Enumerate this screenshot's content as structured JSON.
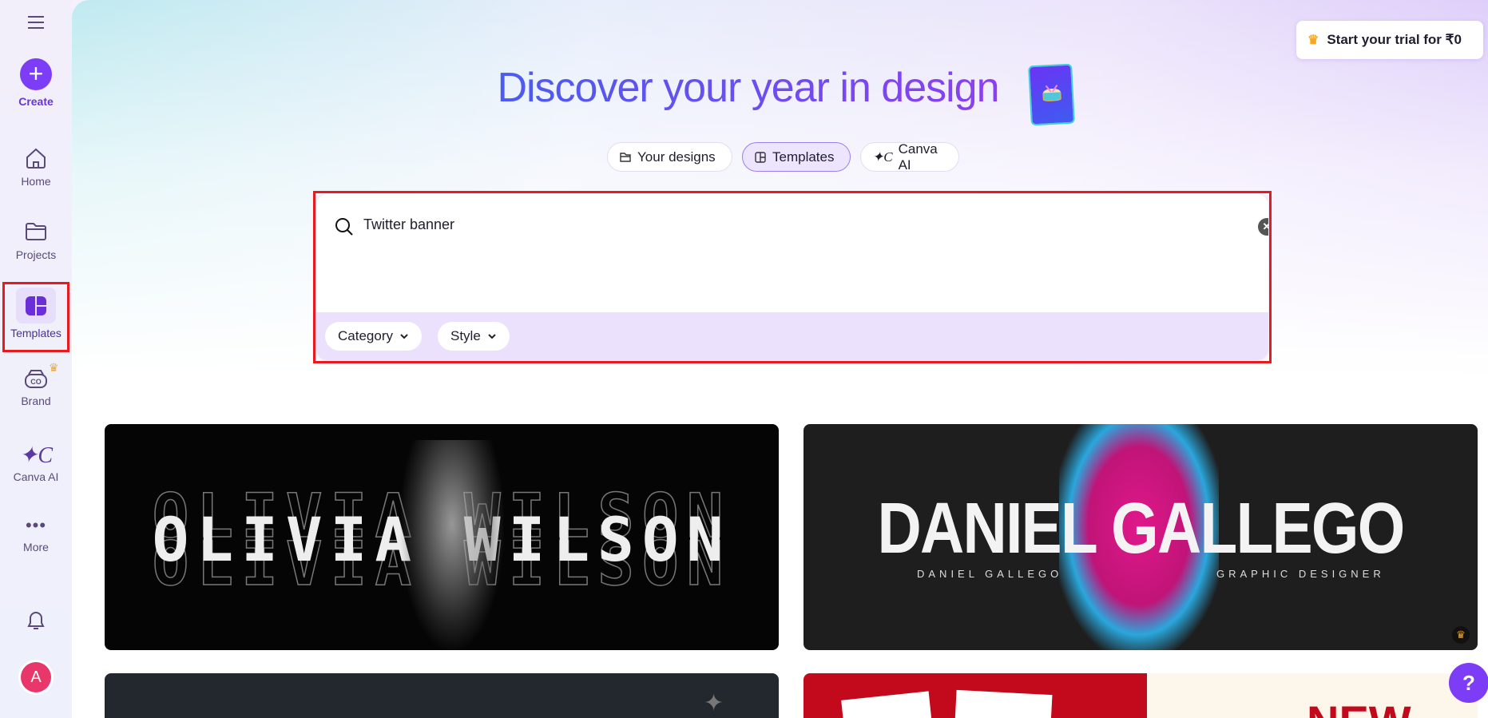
{
  "sidebar": {
    "create": "Create",
    "items": [
      {
        "label": "Home"
      },
      {
        "label": "Projects"
      },
      {
        "label": "Templates"
      },
      {
        "label": "Brand"
      },
      {
        "label": "Canva AI"
      },
      {
        "label": "More"
      }
    ],
    "avatar_initial": "A"
  },
  "header": {
    "title": "Discover your year in design",
    "trial_button": "Start your trial for ₹0",
    "tabs": [
      {
        "label": "Your designs"
      },
      {
        "label": "Templates",
        "active": true
      },
      {
        "label": "Canva AI"
      }
    ]
  },
  "search": {
    "value": "Twitter banner",
    "filters": [
      {
        "label": "Category"
      },
      {
        "label": "Style"
      }
    ]
  },
  "templates": [
    {
      "title": "OLIVIA WILSON"
    },
    {
      "title": "DANIEL GALLEGO",
      "name": "DANIEL GALLEGO",
      "role": "GRAPHIC DESIGNER",
      "premium": true
    },
    {
      "title": ""
    },
    {
      "title": "NEW"
    }
  ],
  "help": "?",
  "colors": {
    "accent": "#7d3cf5",
    "highlight": "#e8191f"
  }
}
